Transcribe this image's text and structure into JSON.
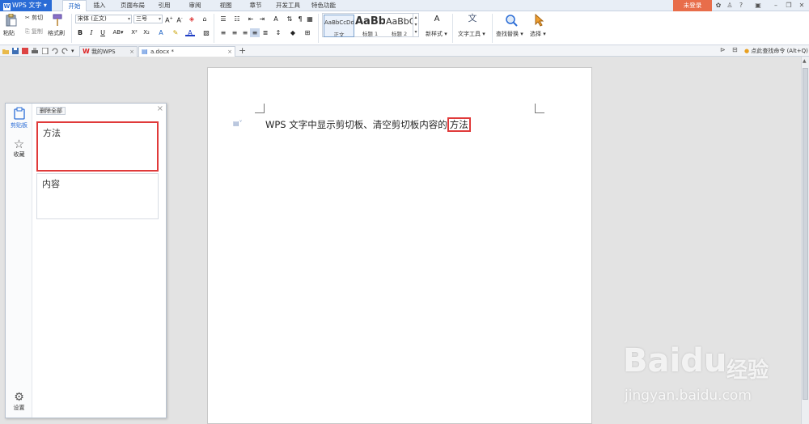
{
  "menubar": {
    "app_name": "WPS 文字",
    "tabs": [
      "开始",
      "插入",
      "页面布局",
      "引用",
      "审阅",
      "视图",
      "章节",
      "开发工具",
      "特色功能"
    ],
    "login": "未登录"
  },
  "ribbon": {
    "paste": "粘贴",
    "cut": "剪切",
    "copy": "复制",
    "format_painter": "格式刷",
    "font_name": "宋体 (正文)",
    "font_size": "三号",
    "styles": [
      {
        "preview": "AaBbCcDd",
        "caption": "正文"
      },
      {
        "preview": "AaBb",
        "caption": "标题 1"
      },
      {
        "preview": "AaBbC",
        "caption": "标题 2"
      }
    ],
    "new_style": "新样式",
    "text_tools": "文字工具",
    "find_replace": "查找替换",
    "select": "选择"
  },
  "quickbar": {
    "tabs": [
      {
        "label": "我的WPS"
      },
      {
        "label": "a.docx *"
      }
    ],
    "command_search": "点此查找命令 (Alt+Q)"
  },
  "clipboard_panel": {
    "nav": [
      {
        "label": "剪贴板"
      },
      {
        "label": "收藏"
      }
    ],
    "settings": "设置",
    "delete_all": "删除全部",
    "items": [
      {
        "text": "方法"
      },
      {
        "text": "内容"
      }
    ]
  },
  "document": {
    "text_before": "WPS 文字中显示剪切板、清空剪切板内容的",
    "highlighted": "方法"
  },
  "watermark": {
    "brand": "Baidu",
    "suffix": "经验",
    "url": "jingyan.baidu.com"
  },
  "colors": {
    "accent": "#2a6cd6",
    "highlight_border": "#e03a3a",
    "login": "#e86d4a"
  }
}
